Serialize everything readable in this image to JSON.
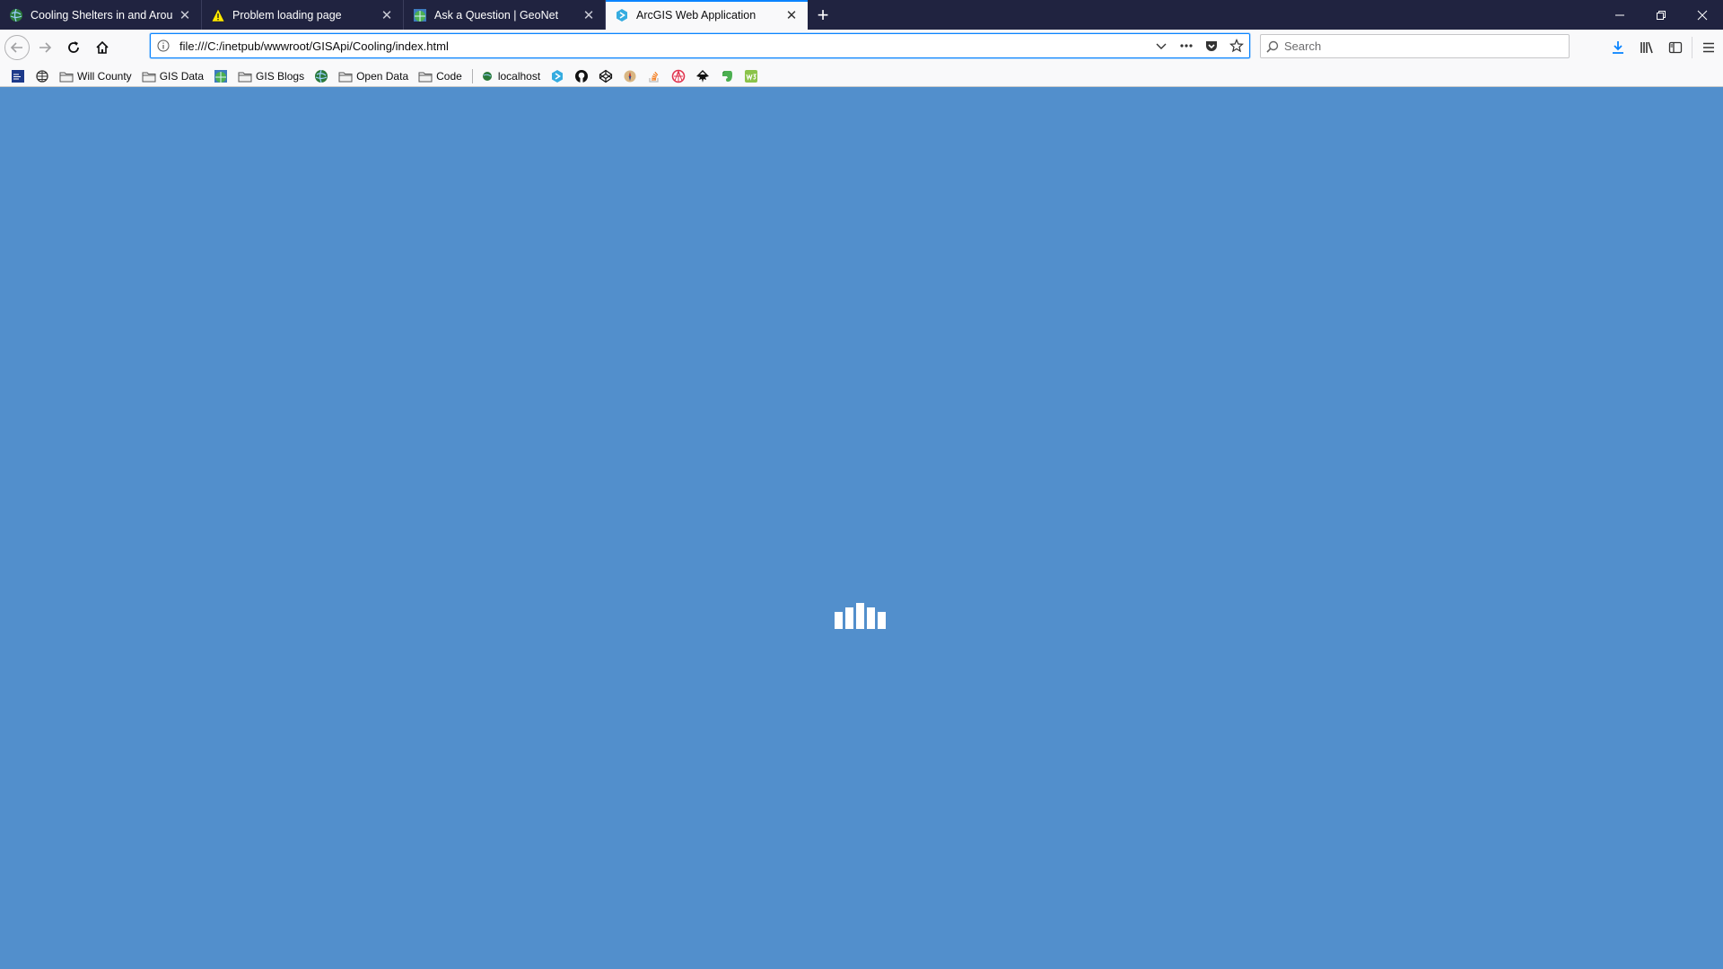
{
  "tabs": [
    {
      "title": "Cooling Shelters in and Around",
      "icon": "globe-esri-icon",
      "active": false
    },
    {
      "title": "Problem loading page",
      "icon": "warning-icon",
      "active": false
    },
    {
      "title": "Ask a Question | GeoNet",
      "icon": "geonet-globe-icon",
      "active": false
    },
    {
      "title": "ArcGIS Web Application",
      "icon": "arcgis-icon",
      "active": true
    }
  ],
  "new_tab_label": "+",
  "window_controls": {
    "minimize": "minimize",
    "restore": "restore",
    "close": "close"
  },
  "navbar": {
    "url": "file:///C:/inetpub/wwwroot/GISApi/Cooling/index.html",
    "search_placeholder": "Search",
    "search_value": ""
  },
  "bookmarks": [
    {
      "label": "",
      "icon": "weather-channel-icon",
      "type": "site"
    },
    {
      "label": "",
      "icon": "globe-icon",
      "type": "site"
    },
    {
      "label": "Will County",
      "icon": "folder-icon",
      "type": "folder"
    },
    {
      "label": "GIS Data",
      "icon": "folder-icon",
      "type": "folder"
    },
    {
      "label": "",
      "icon": "geonet-globe-icon",
      "type": "site"
    },
    {
      "label": "GIS Blogs",
      "icon": "folder-icon",
      "type": "folder"
    },
    {
      "label": "",
      "icon": "esri-globe-icon",
      "type": "site"
    },
    {
      "label": "Open Data",
      "icon": "folder-icon",
      "type": "folder"
    },
    {
      "label": "Code",
      "icon": "folder-icon",
      "type": "folder"
    },
    {
      "label": "localhost",
      "icon": "localhost-globe-icon",
      "type": "site"
    },
    {
      "label": "",
      "icon": "arcgis-icon",
      "type": "site"
    },
    {
      "label": "",
      "icon": "github-icon",
      "type": "site"
    },
    {
      "label": "",
      "icon": "codepen-icon",
      "type": "site"
    },
    {
      "label": "",
      "icon": "compass-icon",
      "type": "site"
    },
    {
      "label": "",
      "icon": "stackoverflow-icon",
      "type": "site"
    },
    {
      "label": "",
      "icon": "red-sphere-icon",
      "type": "site"
    },
    {
      "label": "",
      "icon": "inkscape-icon",
      "type": "site"
    },
    {
      "label": "",
      "icon": "evernote-icon",
      "type": "site"
    },
    {
      "label": "",
      "icon": "w3schools-icon",
      "type": "site"
    }
  ],
  "content": {
    "state": "loading",
    "background_color": "#528fcc",
    "loader_icon": "loading-bars-icon"
  },
  "colors": {
    "titlebar": "#202340",
    "accent": "#0a84ff",
    "page_bg": "#528fcc"
  }
}
